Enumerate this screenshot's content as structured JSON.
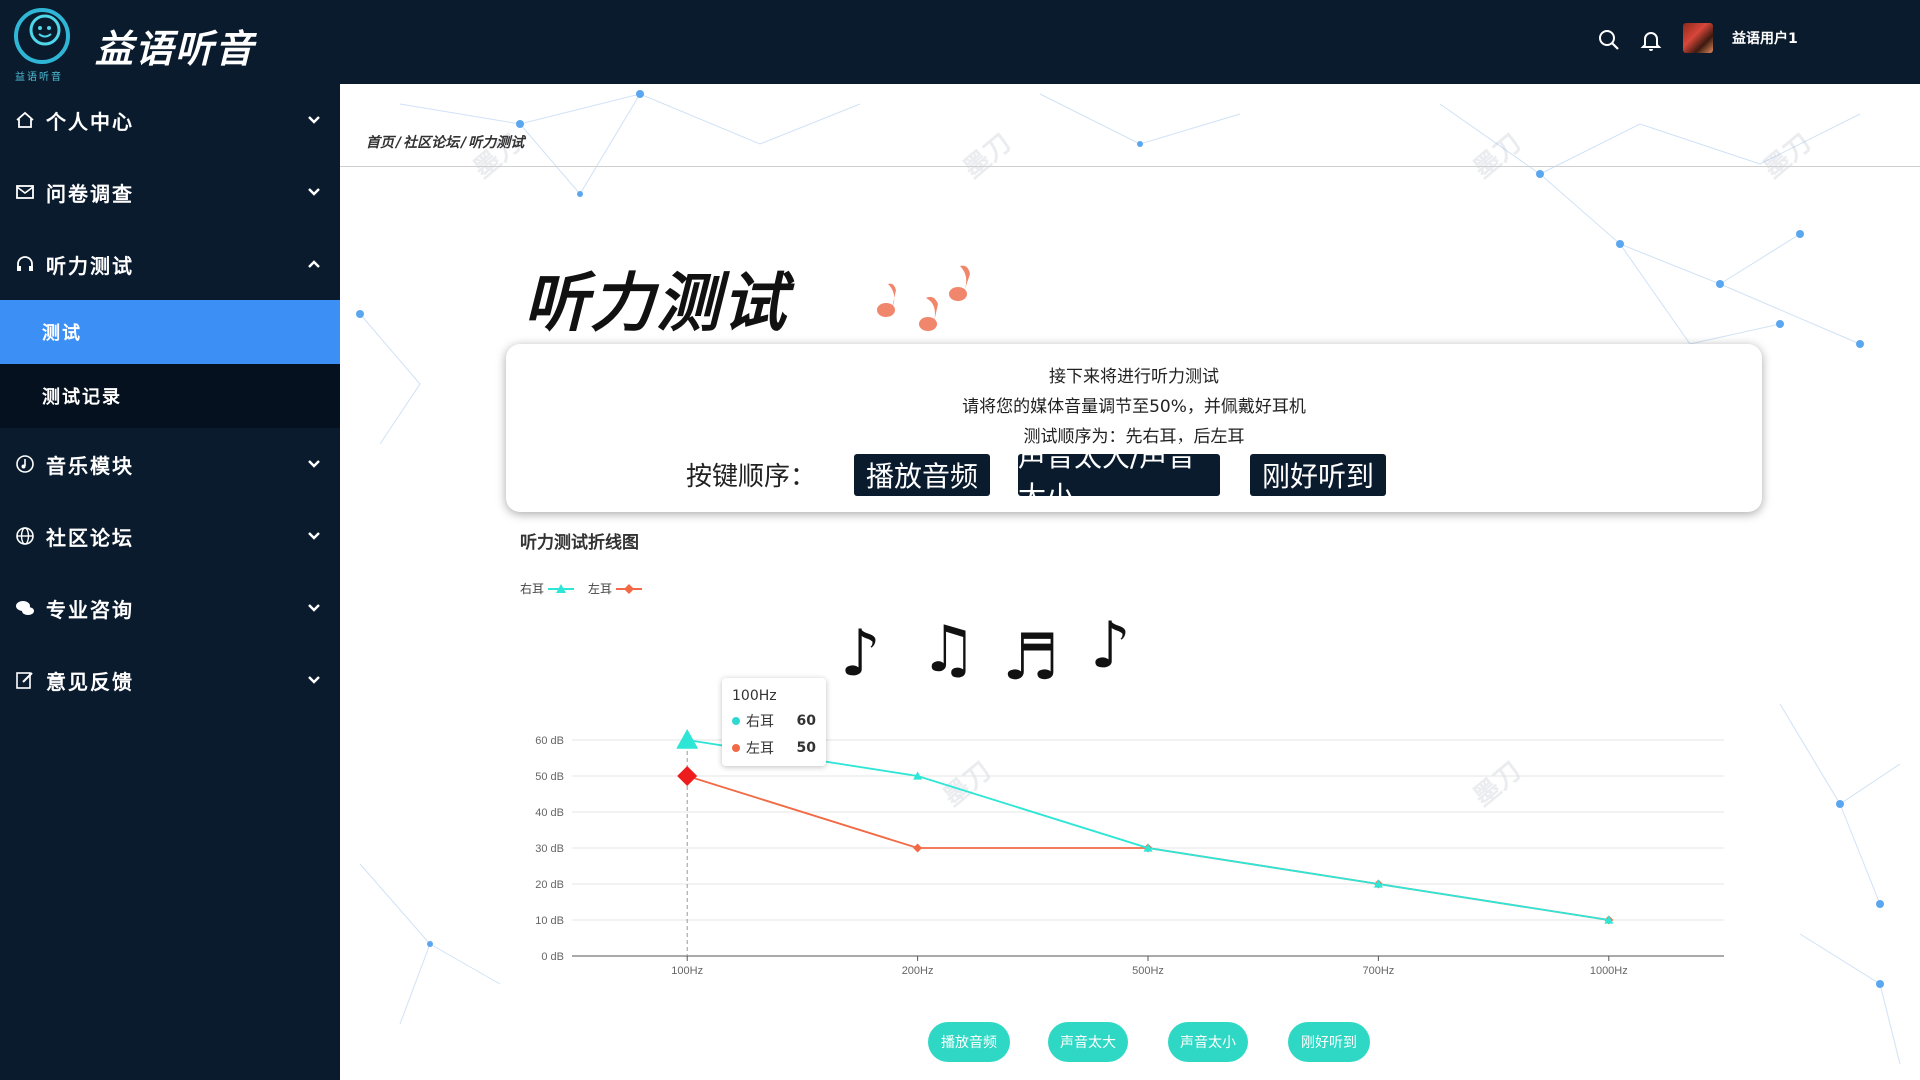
{
  "header": {
    "brand": "益语听音",
    "logo_small": "益语听音",
    "username": "益语用户1",
    "icons": [
      "search-icon",
      "bell-icon"
    ]
  },
  "sidebar": {
    "items": [
      {
        "label": "个人中心",
        "icon": "home-icon"
      },
      {
        "label": "问卷调查",
        "icon": "mail-icon"
      },
      {
        "label": "听力测试",
        "icon": "headphones-icon",
        "expanded": true
      },
      {
        "label": "音乐模块",
        "icon": "music-icon"
      },
      {
        "label": "社区论坛",
        "icon": "globe-icon"
      },
      {
        "label": "专业咨询",
        "icon": "chat-icon"
      },
      {
        "label": "意见反馈",
        "icon": "edit-icon"
      }
    ],
    "sub_items": [
      {
        "label": "测试",
        "active": true
      },
      {
        "label": "测试记录",
        "active": false
      }
    ]
  },
  "breadcrumb": {
    "home": "首页",
    "sep": "/",
    "forum": "社区论坛",
    "current": "听力测试"
  },
  "main": {
    "title": "听力测试",
    "info": {
      "line1": "接下来将进行听力测试",
      "line2": "请将您的媒体音量调节至50%，并佩戴好耳机",
      "line3": "测试顺序为：先右耳，后左耳",
      "key_label": "按键顺序：",
      "key_buttons": [
        "播放音频",
        "声音太大/声音太小",
        "刚好听到"
      ]
    },
    "chart_title": "听力测试折线图",
    "bottom_buttons": [
      "播放音频",
      "声音太大",
      "声音太小",
      "刚好听到"
    ],
    "tooltip": {
      "title": "100Hz",
      "rows": [
        {
          "name": "右耳",
          "value": "60",
          "color": "#2fd8d0"
        },
        {
          "name": "左耳",
          "value": "50",
          "color": "#f26a45"
        }
      ]
    }
  },
  "chart_data": {
    "type": "line",
    "categories": [
      "100Hz",
      "200Hz",
      "500Hz",
      "700Hz",
      "1000Hz"
    ],
    "series": [
      {
        "name": "右耳",
        "values": [
          60,
          50,
          30,
          20,
          10
        ],
        "color": "#2ee6d6"
      },
      {
        "name": "左耳",
        "values": [
          50,
          30,
          30,
          20,
          10
        ],
        "color": "#f26a45"
      }
    ],
    "yticks": [
      "0 dB",
      "10 dB",
      "20 dB",
      "30 dB",
      "40 dB",
      "50 dB",
      "60 dB"
    ],
    "ylim": [
      0,
      60
    ],
    "grid": true,
    "legend_position": "top-left"
  }
}
